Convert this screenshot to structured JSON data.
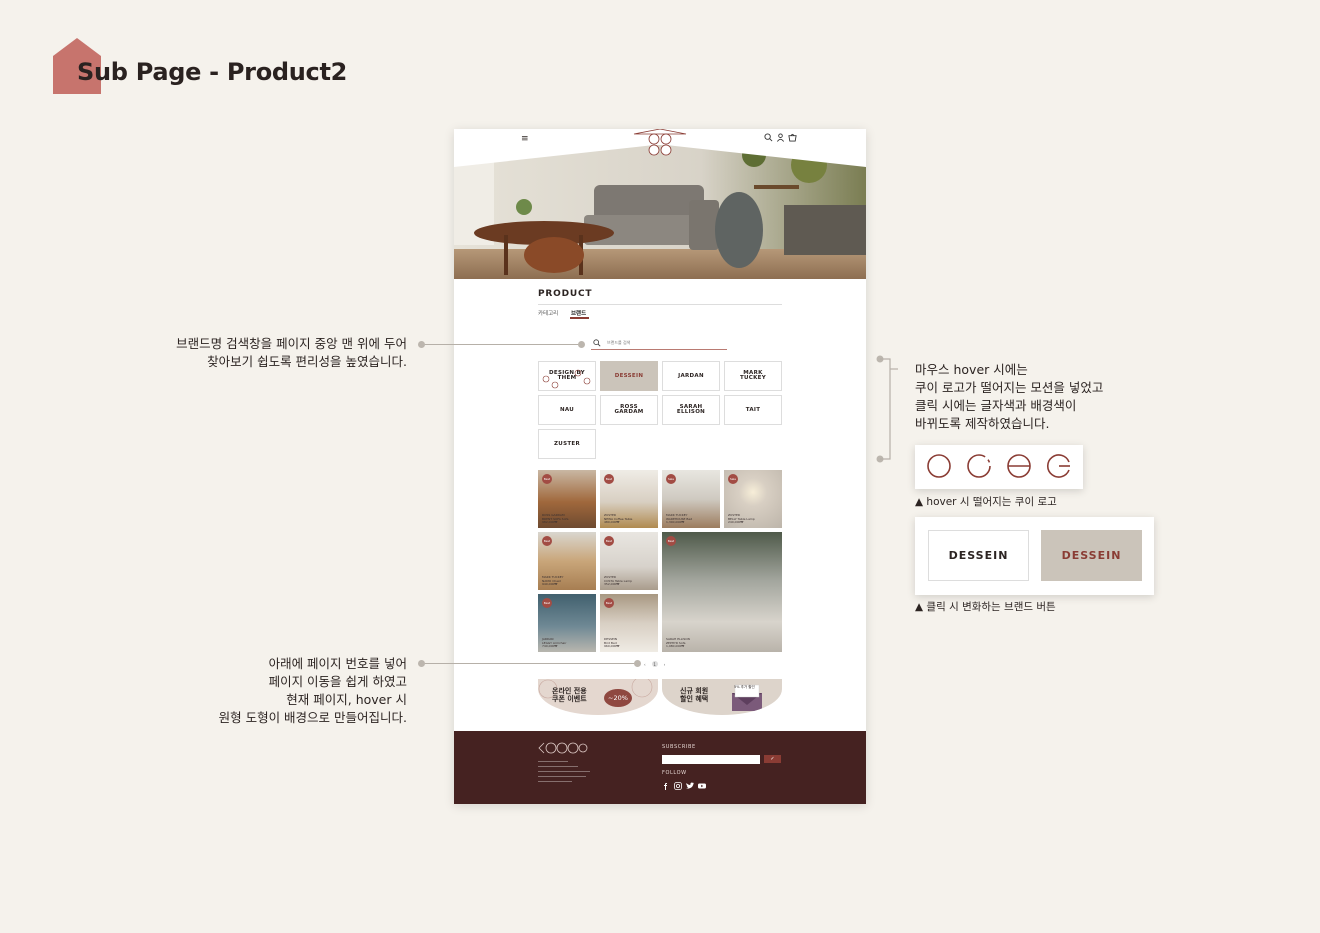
{
  "page_title": "Sub Page - Product2",
  "colors": {
    "accent": "#8a3c34",
    "background": "#f5f2ec",
    "footer": "#452221",
    "active_button_bg": "#cbc4ba"
  },
  "mockup": {
    "product_title": "PRODUCT",
    "tabs": [
      "카테고리",
      "브랜드"
    ],
    "search_placeholder": "브랜드를 검색",
    "brands": [
      "DESIGN BY THEM",
      "DESSEIN",
      "JARDAN",
      "MARK TUCKEY",
      "NAU",
      "ROSS GARDAM",
      "SARAH ELLISON",
      "TAIT",
      "ZUSTER"
    ],
    "active_brand": "DESSEIN",
    "products": [
      {
        "name": "ROSS GARDAM\nBRENT SOFA Sofa",
        "price": "982,000₩",
        "badge": "Best"
      },
      {
        "name": "ZUSTER\nNEWA Coffee Table",
        "price": "480,000₩",
        "badge": "Best"
      },
      {
        "name": "MARK TUCKEY\nWAREHOUSE Bed",
        "price": "1,300,000₩",
        "badge": "Sale"
      },
      {
        "name": "ZUSTER\nBELLY Table Lamp",
        "price": "240,000₩",
        "badge": "Sale"
      },
      {
        "name": "MARK TUCKEY\nNAMO Chest",
        "price": "940,000₩",
        "badge": "Best"
      },
      {
        "name": "ZUSTER\nCOSTA Table Lamp",
        "price": "352,000₩",
        "badge": "Best"
      },
      {
        "name": "SARAH ELLISON\nZEPHYR Sofa",
        "price": "1,980,000₩",
        "badge": "Best"
      },
      {
        "name": "JARDAN\nLEGGY Armchair",
        "price": "740,000₩",
        "badge": "Best"
      },
      {
        "name": "DESSEIN\nBird Bed",
        "price": "960,000₩",
        "badge": "Best"
      }
    ],
    "pager": [
      "‹",
      "1",
      "›"
    ],
    "banner1": {
      "text": "온라인 전용\n쿠폰 이벤트",
      "discount": "~20%"
    },
    "banner2": {
      "text": "신규 회원\n할인 혜택",
      "tag": "5% 추가 할인"
    },
    "footer": {
      "subscribe": "SUBSCRIBE",
      "follow": "FOLLOW",
      "submit": "✓"
    }
  },
  "annotations": {
    "search_note": "브랜드명 검색창을 페이지 중앙 맨 위에 두어\n찾아보기 쉽도록 편리성을 높였습니다.",
    "pager_note": "아래에 페이지 번호를 넣어\n페이지 이동을 쉽게 하였고\n현재 페이지, hover 시\n원형 도형이 배경으로 만들어집니다.",
    "hover_note": "마우스 hover 시에는\n쿠이 로고가 떨어지는 모션을 넣었고\n클릭 시에는 글자색과 배경색이\n바뀌도록 제작하였습니다.",
    "hover_caption": "▲ hover 시 떨어지는 쿠이 로고",
    "button_caption": "▲ 클릭 시 변화하는 브랜드 버튼",
    "button_normal": "DESSEIN",
    "button_clicked": "DESSEIN"
  }
}
